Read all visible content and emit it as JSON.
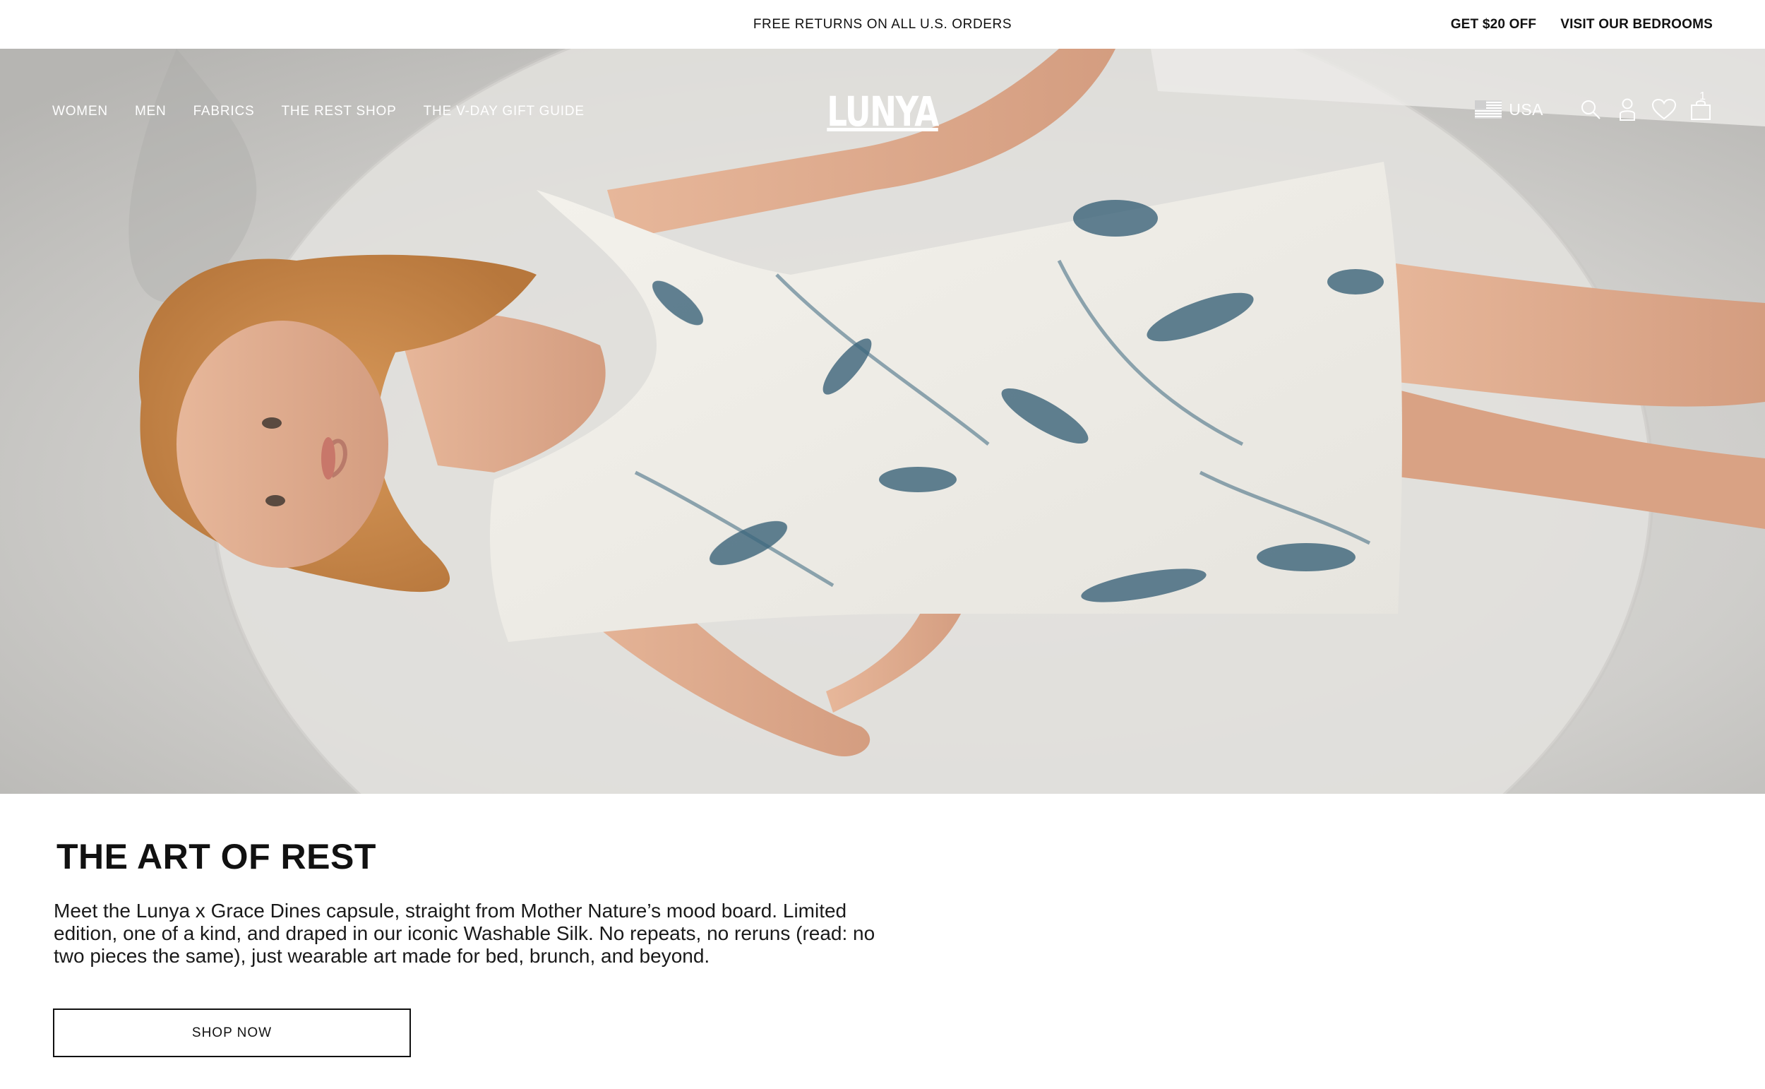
{
  "announcement": {
    "center_text": "FREE RETURNS ON ALL U.S. ORDERS",
    "promo_link": "GET $20 OFF",
    "bedrooms_link": "VISIT OUR BEDROOMS"
  },
  "nav": {
    "items": [
      {
        "label": "WOMEN"
      },
      {
        "label": "MEN"
      },
      {
        "label": "FABRICS"
      },
      {
        "label": "THE REST SHOP"
      },
      {
        "label": "THE V-DAY GIFT GUIDE"
      }
    ],
    "logo": "LUNYA",
    "locale": "USA",
    "cart_count": "1",
    "icons": [
      "us-flag-icon",
      "search-icon",
      "account-icon",
      "wishlist-heart-icon",
      "cart-bag-icon"
    ]
  },
  "hero": {
    "image": "hero-photo"
  },
  "feature": {
    "headline": "THE ART OF REST",
    "body": "Meet the Lunya x Grace Dines capsule, straight from Mother Nature’s mood board. Limited edition, one of a kind, and draped in our iconic Washable Silk. No repeats, no reruns (read: no two pieces the same), just wearable art made for bed, brunch, and beyond.",
    "cta": "SHOP NOW"
  },
  "colors": {
    "text": "#111111",
    "background": "#ffffff",
    "print_blue": "#2f5a72",
    "hair": "#c88a4a"
  }
}
